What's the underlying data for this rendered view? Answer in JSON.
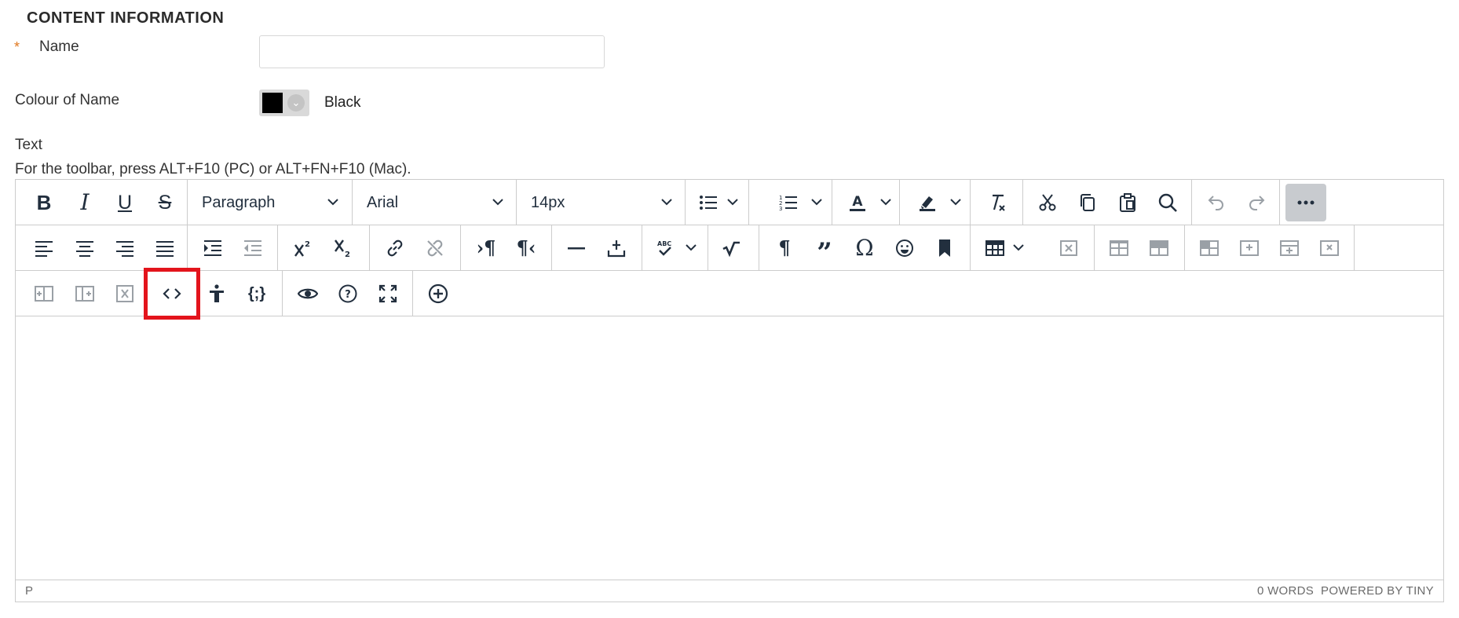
{
  "section": {
    "title": "CONTENT INFORMATION"
  },
  "fields": {
    "name": {
      "label": "Name",
      "required_mark": "*",
      "value": ""
    },
    "colour": {
      "label": "Colour of Name",
      "value_text": "Black",
      "swatch": "#000000"
    }
  },
  "text_field": {
    "label": "Text",
    "toolbar_hint": "For the toolbar, press ALT+F10 (PC) or ALT+FN+F10 (Mac)."
  },
  "toolbar": {
    "block_format": "Paragraph",
    "font_family": "Arial",
    "font_size": "14px",
    "highlighted_button": "source-code-button",
    "highlight_color": "#e3141c"
  },
  "status_bar": {
    "path": "P",
    "word_count": "0 WORDS",
    "branding": "POWERED BY TINY"
  }
}
